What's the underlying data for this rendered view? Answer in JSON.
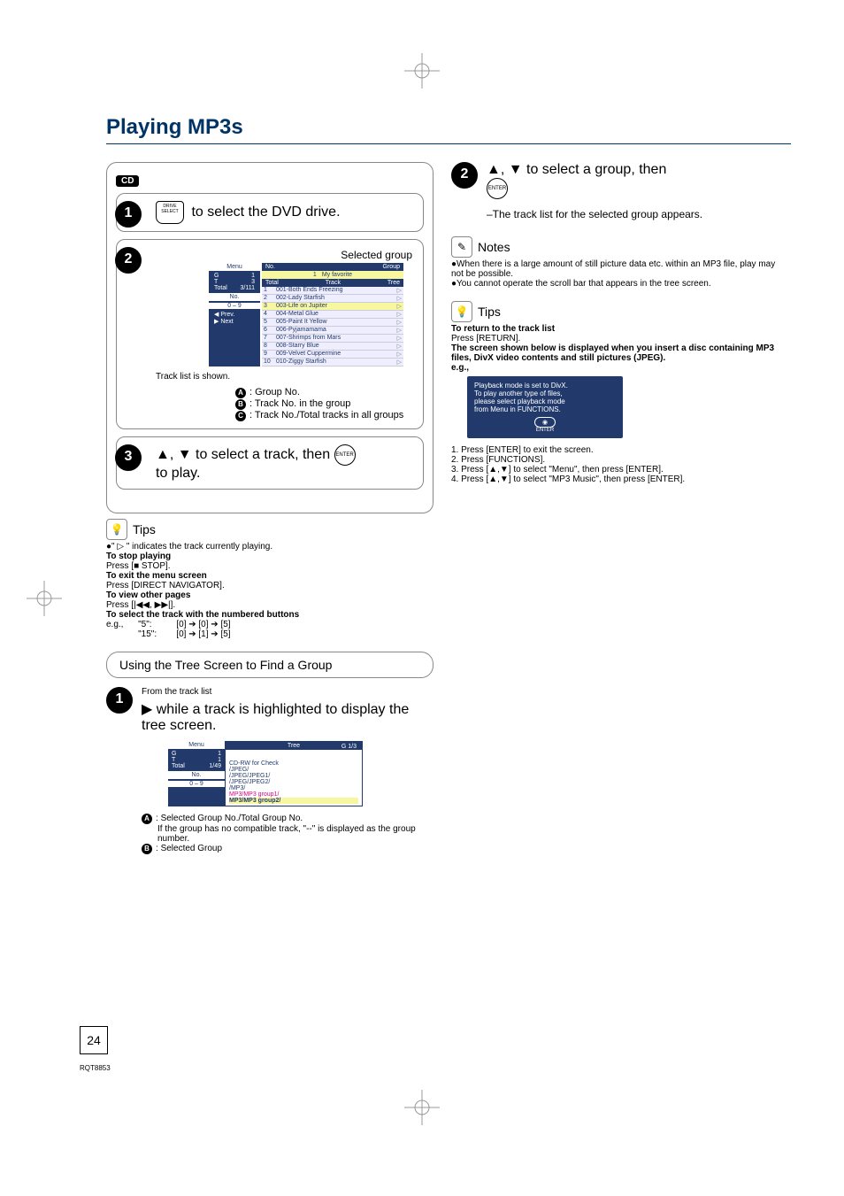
{
  "title": "Playing MP3s",
  "cd_badge": "CD",
  "step1": {
    "drive_label": "DRIVE\nSELECT",
    "text": "to select the DVD drive."
  },
  "step2": {
    "selected_group_label": "Selected group",
    "track_list_shown": "Track list is shown.",
    "menu_label": "Menu",
    "g": "G",
    "g_val": "1",
    "t": "T",
    "t_val": "3",
    "total": "Total",
    "total_val": "3/111",
    "no_label": "No.",
    "no_range": "0 – 9",
    "prev": "Prev.",
    "next": "Next",
    "header_no": "No.",
    "header_group": "Group",
    "fav": "My favorite",
    "header_total": "Total",
    "header_track": "Track",
    "header_tree": "Tree",
    "rows": [
      {
        "n": "1",
        "t": "001-Both Ends Freezing"
      },
      {
        "n": "2",
        "t": "002-Lady Starfish"
      },
      {
        "n": "3",
        "t": "003-Life on Jupiter"
      },
      {
        "n": "4",
        "t": "004-Metal Glue"
      },
      {
        "n": "5",
        "t": "005-Paint It Yellow"
      },
      {
        "n": "6",
        "t": "006-Pyjamamama"
      },
      {
        "n": "7",
        "t": "007-Shrimps from Mars"
      },
      {
        "n": "8",
        "t": "008-Starry Blue"
      },
      {
        "n": "9",
        "t": "009-Velvet Cuppermine"
      },
      {
        "n": "10",
        "t": "010-Ziggy Starfish"
      }
    ],
    "legendA": "Group No.",
    "legendB": "Track No. in the group",
    "legendC": "Track No./Total tracks in all groups"
  },
  "step3": {
    "text_select": ", ▼ to select a track, then",
    "text_play": "to play.",
    "enter": "ENTER"
  },
  "tips_title": "Tips",
  "tips_body": {
    "l1": "\" ▷ \" indicates the track currently playing.",
    "l2_h": "To stop playing",
    "l2_b": "Press [■ STOP].",
    "l3_h": "To exit the menu screen",
    "l3_b": "Press [DIRECT NAVIGATOR].",
    "l4_h": "To view other pages",
    "l4_b": "Press [|◀◀, ▶▶|].",
    "l5_h": "To select the track with the numbered buttons",
    "l5_b1": "e.g.,      \"5\":          [0] ➔ [0] ➔ [5]",
    "l5_b2": "             \"15\":        [0] ➔ [1] ➔ [5]"
  },
  "tree_section": "Using the Tree Screen to Find a Group",
  "tree_step1": {
    "from": "From the track list",
    "text": "▶ while a track is highlighted to display the tree screen.",
    "menu_label": "Menu",
    "g": "G",
    "g_val": "1",
    "t": "T",
    "t_val": "1",
    "total": "Total",
    "total_val": "1/49",
    "no_label": "No.",
    "no_range": "0 – 9",
    "tree_label": "Tree",
    "g_label": "G",
    "g_val2": "1/3",
    "lines": [
      "CD-RW for Check",
      "/JPEG/",
      "/JPEG/JPEG1/",
      "/JPEG/JPEG2/",
      "/MP3/",
      "MP3/MP3 group1/",
      "MP3/MP3 group2/"
    ],
    "legA": "Selected Group No./Total Group No.",
    "legA2": "If the group has no compatible track, \"--\" is displayed as the group number.",
    "legB": "Selected Group"
  },
  "right_step2": {
    "text": ", ▼ to select a group, then",
    "enter": "ENTER",
    "sub": "–The track list for the selected group appears."
  },
  "notes_title": "Notes",
  "notes": [
    "When there is a large amount of still picture data etc. within an MP3 file, play may not be possible.",
    "You cannot operate the scroll bar that appears in the tree screen."
  ],
  "right_tips_title": "Tips",
  "right_tips": {
    "l1_h": "To return to the track list",
    "l1_b": "Press [RETURN].",
    "l2_h": "The screen shown below is displayed when you insert a disc containing MP3 files, DivX video contents and still pictures (JPEG).",
    "eg": "e.g.,",
    "dialog": [
      "Playback mode is set to DivX.",
      "To play another type of files,",
      "please select playback mode",
      "from Menu in FUNCTIONS."
    ],
    "enter_ok": "ENTER",
    "steps": [
      "1. Press [ENTER] to exit the screen.",
      "2. Press [FUNCTIONS].",
      "3. Press [▲,▼] to select \"Menu\", then press [ENTER].",
      "4. Press [▲,▼] to select \"MP3 Music\", then press [ENTER]."
    ]
  },
  "page_number": "24",
  "rqt": "RQT8853"
}
